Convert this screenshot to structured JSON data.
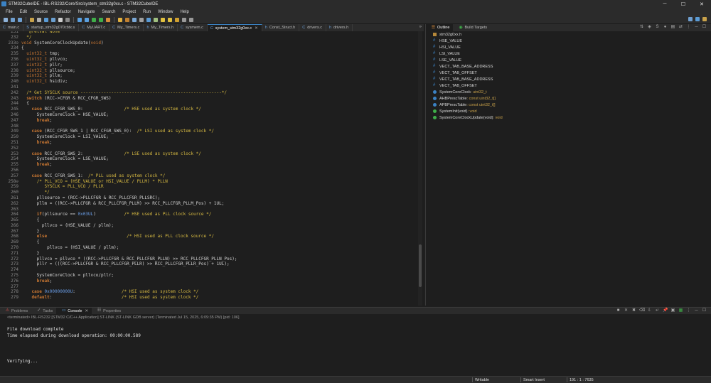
{
  "window": {
    "title": "STM32CubeIDE - IBL-RS232/Core/Src/system_stm32g0xx.c - STM32CubeIDE",
    "minimize": "─",
    "maximize": "☐",
    "close": "✕"
  },
  "menu": [
    "File",
    "Edit",
    "Source",
    "Refactor",
    "Navigate",
    "Search",
    "Project",
    "Run",
    "Window",
    "Help"
  ],
  "editor_tabs": [
    {
      "label": "main.c",
      "active": false
    },
    {
      "label": "startup_stm32g070cbtx.s",
      "active": false
    },
    {
      "label": "MyUART.c",
      "active": false
    },
    {
      "label": "My_Timers.c",
      "active": false
    },
    {
      "label": "My_Timers.h",
      "active": false
    },
    {
      "label": "sysmem.c",
      "active": false
    },
    {
      "label": "system_stm32g0xx.c",
      "active": true
    },
    {
      "label": "Const_Struct.h",
      "active": false
    },
    {
      "label": "drivers.c",
      "active": false
    },
    {
      "label": "drivers.h",
      "active": false
    }
  ],
  "editor_tabs_overflow": "»",
  "code_lines": [
    {
      "n": "231",
      "html": "   <span class=\"cm\">@retval None</span>"
    },
    {
      "n": "232",
      "html": "  <span class=\"cm\">*/</span>"
    },
    {
      "n": "233⊖",
      "html": "<span class=\"ty\">void</span> SystemCoreClockUpdate(<span class=\"ty\">void</span>)"
    },
    {
      "n": "234",
      "html": "{"
    },
    {
      "n": "235",
      "html": "  <span class=\"ty\">uint32_t</span> tmp;"
    },
    {
      "n": "236",
      "html": "  <span class=\"ty\">uint32_t</span> pllvco;"
    },
    {
      "n": "237",
      "html": "  <span class=\"ty\">uint32_t</span> pllr;"
    },
    {
      "n": "238",
      "html": "  <span class=\"ty\">uint32_t</span> pllsource;"
    },
    {
      "n": "239",
      "html": "  <span class=\"ty\">uint32_t</span> pllm;"
    },
    {
      "n": "240",
      "html": "  <span class=\"ty\">uint32_t</span> hsidiv;"
    },
    {
      "n": "241",
      "html": ""
    },
    {
      "n": "242",
      "html": "  <span class=\"cm\">/* Get SYSCLK source -------------------------------------------------------*/</span>"
    },
    {
      "n": "243",
      "html": "  <span class=\"kw\">switch</span> (RCC-&gt;CFGR &amp; RCC_CFGR_SWS)"
    },
    {
      "n": "244",
      "html": "  {"
    },
    {
      "n": "245",
      "html": "    <span class=\"kw\">case</span> RCC_CFGR_SWS_0:                <span class=\"cm\">/* HSE used as system clock */</span>"
    },
    {
      "n": "246",
      "html": "      SystemCoreClock = HSE_VALUE;"
    },
    {
      "n": "247",
      "html": "      <span class=\"kw\">break</span>;"
    },
    {
      "n": "248",
      "html": ""
    },
    {
      "n": "249",
      "html": "    <span class=\"kw\">case</span> (RCC_CFGR_SWS_1 | RCC_CFGR_SWS_0):  <span class=\"cm\">/* LSI used as system clock */</span>"
    },
    {
      "n": "250",
      "html": "      SystemCoreClock = LSI_VALUE;"
    },
    {
      "n": "251",
      "html": "      <span class=\"kw\">break</span>;"
    },
    {
      "n": "252",
      "html": ""
    },
    {
      "n": "253",
      "html": "    <span class=\"kw\">case</span> RCC_CFGR_SWS_2:                <span class=\"cm\">/* LSE used as system clock */</span>"
    },
    {
      "n": "254",
      "html": "      SystemCoreClock = LSE_VALUE;"
    },
    {
      "n": "255",
      "html": "      <span class=\"kw\">break</span>;"
    },
    {
      "n": "256",
      "html": ""
    },
    {
      "n": "257",
      "html": "    <span class=\"kw\">case</span> RCC_CFGR_SWS_1:  <span class=\"cm\">/* PLL used as system clock */</span>"
    },
    {
      "n": "258⊖",
      "html": "      <span class=\"cm\">/* PLL_VCO = (HSE_VALUE or HSI_VALUE / PLLM) * PLLN</span>"
    },
    {
      "n": "259",
      "html": "<span class=\"cm\">         SYSCLK = PLL_VCO / PLLR</span>"
    },
    {
      "n": "260",
      "html": "<span class=\"cm\">         */</span>"
    },
    {
      "n": "261",
      "html": "      pllsource = (RCC-&gt;PLLCFGR &amp; RCC_PLLCFGR_PLLSRC);"
    },
    {
      "n": "262",
      "html": "      pllm = ((RCC-&gt;PLLCFGR &amp; RCC_PLLCFGR_PLLM) &gt;&gt; RCC_PLLCFGR_PLLM_Pos) + 1UL;"
    },
    {
      "n": "263",
      "html": ""
    },
    {
      "n": "264",
      "html": "      <span class=\"kw\">if</span>(pllsource == <span class=\"num\">0x03UL</span>)           <span class=\"cm\">/* HSE used as PLL clock source */</span>"
    },
    {
      "n": "265",
      "html": "      {"
    },
    {
      "n": "266",
      "html": "        pllvco = (HSE_VALUE / pllm);"
    },
    {
      "n": "267",
      "html": "      }"
    },
    {
      "n": "268",
      "html": "      <span class=\"kw\">else</span>                               <span class=\"cm\">/* HSI used as PLL clock source */</span>"
    },
    {
      "n": "269",
      "html": "      {"
    },
    {
      "n": "270",
      "html": "          pllvco = (HSI_VALUE / pllm);"
    },
    {
      "n": "271",
      "html": "      }"
    },
    {
      "n": "272",
      "html": "      pllvco = pllvco * ((RCC-&gt;PLLCFGR &amp; RCC_PLLCFGR_PLLN) &gt;&gt; RCC_PLLCFGR_PLLN_Pos);"
    },
    {
      "n": "273",
      "html": "      pllr = (((RCC-&gt;PLLCFGR &amp; RCC_PLLCFGR_PLLR) &gt;&gt; RCC_PLLCFGR_PLLR_Pos) + 1UL);"
    },
    {
      "n": "274",
      "html": ""
    },
    {
      "n": "275",
      "html": "      SystemCoreClock = pllvco/pllr;"
    },
    {
      "n": "276",
      "html": "      <span class=\"kw\">break</span>;"
    },
    {
      "n": "277",
      "html": ""
    },
    {
      "n": "278",
      "html": "    <span class=\"kw\">case</span> <span class=\"num\">0x00000000U</span>:                  <span class=\"cm\">/* HSI used as system clock */</span>"
    },
    {
      "n": "279",
      "html": "    <span class=\"kw\">default</span>:                           <span class=\"cm\">/* HSI used as system clock */</span>"
    }
  ],
  "outline_tabs": [
    {
      "label": "Outline",
      "active": true
    },
    {
      "label": "Build Targets",
      "active": false
    }
  ],
  "outline_items": [
    {
      "label": "stm32g0xx.h",
      "type": "",
      "bullet": "#b5883a",
      "shape": "square"
    },
    {
      "label": "HSE_VALUE",
      "type": "",
      "bullet": "#3b82c4",
      "shape": "hash"
    },
    {
      "label": "HSI_VALUE",
      "type": "",
      "bullet": "#3b82c4",
      "shape": "hash"
    },
    {
      "label": "LSI_VALUE",
      "type": "",
      "bullet": "#3b82c4",
      "shape": "hash"
    },
    {
      "label": "LSE_VALUE",
      "type": "",
      "bullet": "#3b82c4",
      "shape": "hash"
    },
    {
      "label": "VECT_TAB_BASE_ADDRESS",
      "type": "",
      "bullet": "#3b82c4",
      "shape": "hash"
    },
    {
      "label": "VECT_TAB_OFFSET",
      "type": "",
      "bullet": "#3b82c4",
      "shape": "hash"
    },
    {
      "label": "VECT_TAB_BASE_ADDRESS",
      "type": "",
      "bullet": "#3b82c4",
      "shape": "hash"
    },
    {
      "label": "VECT_TAB_OFFSET",
      "type": "",
      "bullet": "#3b82c4",
      "shape": "hash"
    },
    {
      "label": "SystemCoreClock",
      "type": " : uint32_t",
      "bullet": "#3b82c4",
      "shape": "dot"
    },
    {
      "label": "AHBPrescTable",
      "type": " : const uint32_t[]",
      "bullet": "#3b82c4",
      "shape": "dot"
    },
    {
      "label": "APBPrescTable",
      "type": " : const uint32_t[]",
      "bullet": "#3b82c4",
      "shape": "dot"
    },
    {
      "label": "SystemInit(void)",
      "type": " : void",
      "bullet": "#3fae49",
      "shape": "dot"
    },
    {
      "label": "SystemCoreClockUpdate(void)",
      "type": " : void",
      "bullet": "#3fae49",
      "shape": "dot"
    }
  ],
  "console_tabs": [
    {
      "label": "Problems",
      "active": false
    },
    {
      "label": "Tasks",
      "active": false
    },
    {
      "label": "Console",
      "active": true
    },
    {
      "label": "Properties",
      "active": false
    }
  ],
  "console_status": "<terminated> IBL-RS232 [STM32 C/C++ Application] ST-LINK (ST-LINK GDB server) (Terminated Jul 15, 2025, 6:09:35 PM) [pid: 106]",
  "console_lines": [
    "File download complete",
    "Time elapsed during download operation: 00:00:00.589",
    "",
    "",
    "",
    "Verifying..."
  ],
  "statusbar": {
    "writable": "Writable",
    "insert_mode": "Smart Insert",
    "position": "191 : 1 : 7635"
  },
  "colors": {
    "accent": "#3b82c4",
    "keyword": "#cc7832",
    "comment": "#d7ba42",
    "background": "#1e1e1e"
  }
}
